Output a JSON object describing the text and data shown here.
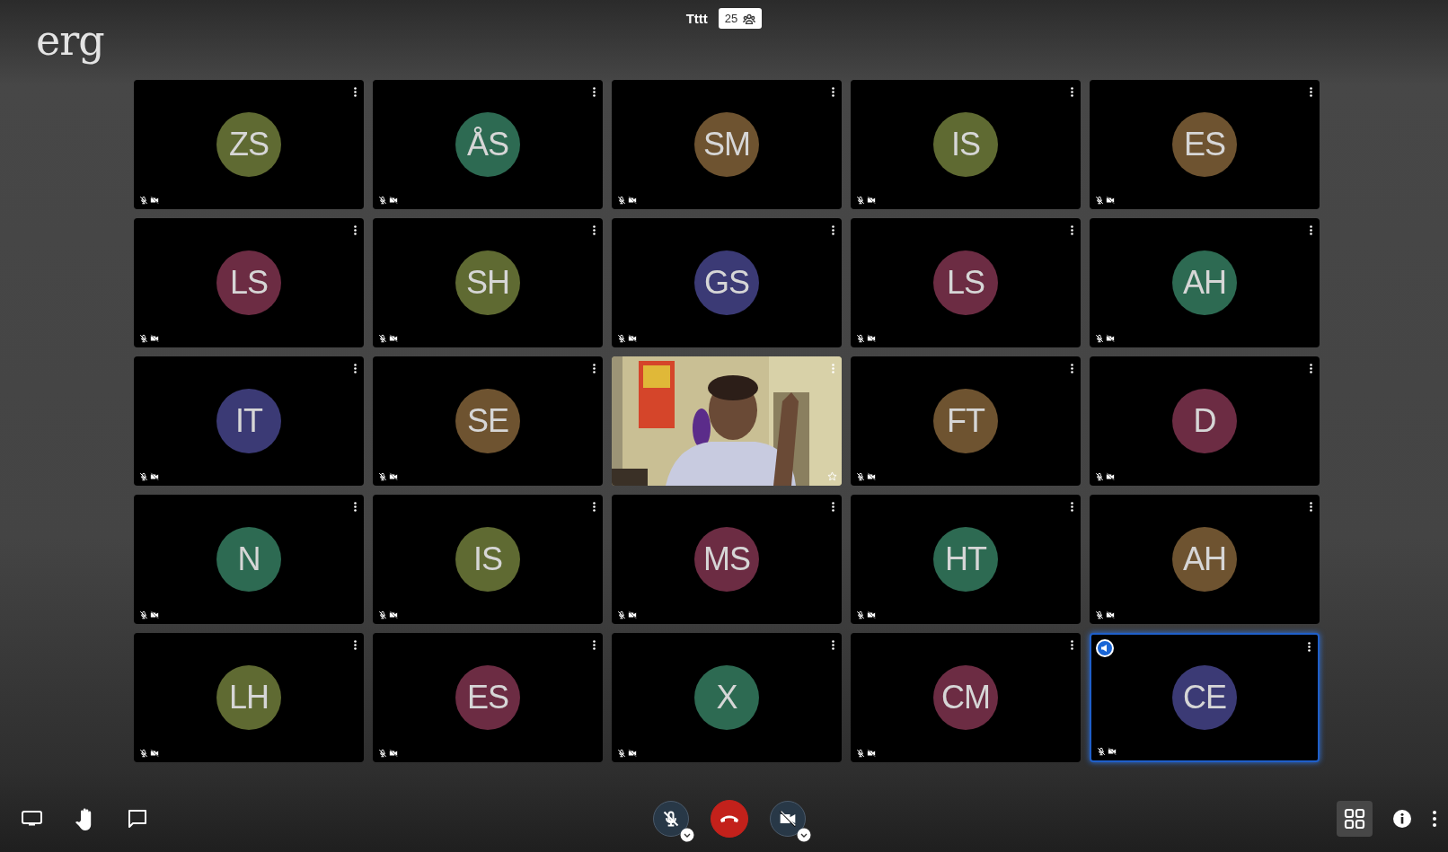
{
  "logo": "erg",
  "meeting": {
    "title": "Tttt",
    "participant_count": "25"
  },
  "tiles": [
    {
      "kind": "avatar",
      "initials": "ZS",
      "color": "#5f6a32",
      "selected": false
    },
    {
      "kind": "avatar",
      "initials": "ÅS",
      "color": "#2d6a52",
      "selected": false
    },
    {
      "kind": "avatar",
      "initials": "SM",
      "color": "#6e5330",
      "selected": false
    },
    {
      "kind": "avatar",
      "initials": "IS",
      "color": "#5f6a32",
      "selected": false
    },
    {
      "kind": "avatar",
      "initials": "ES",
      "color": "#6e5330",
      "selected": false
    },
    {
      "kind": "avatar",
      "initials": "LS",
      "color": "#6c2c43",
      "selected": false
    },
    {
      "kind": "avatar",
      "initials": "SH",
      "color": "#5f6a32",
      "selected": false
    },
    {
      "kind": "avatar",
      "initials": "GS",
      "color": "#3b3a75",
      "selected": false
    },
    {
      "kind": "avatar",
      "initials": "LS",
      "color": "#6c2c43",
      "selected": false
    },
    {
      "kind": "avatar",
      "initials": "AH",
      "color": "#2d6a52",
      "selected": false
    },
    {
      "kind": "avatar",
      "initials": "IT",
      "color": "#3b3a75",
      "selected": false
    },
    {
      "kind": "avatar",
      "initials": "SE",
      "color": "#6e5330",
      "selected": false
    },
    {
      "kind": "video",
      "selected": false
    },
    {
      "kind": "avatar",
      "initials": "FT",
      "color": "#6e5330",
      "selected": false
    },
    {
      "kind": "avatar",
      "initials": "D",
      "color": "#6c2c43",
      "selected": false
    },
    {
      "kind": "avatar",
      "initials": "N",
      "color": "#2d6a52",
      "selected": false
    },
    {
      "kind": "avatar",
      "initials": "IS",
      "color": "#5f6a32",
      "selected": false
    },
    {
      "kind": "avatar",
      "initials": "MS",
      "color": "#6c2c43",
      "selected": false
    },
    {
      "kind": "avatar",
      "initials": "HT",
      "color": "#2d6a52",
      "selected": false
    },
    {
      "kind": "avatar",
      "initials": "AH",
      "color": "#6e5330",
      "selected": false
    },
    {
      "kind": "avatar",
      "initials": "LH",
      "color": "#5f6a32",
      "selected": false
    },
    {
      "kind": "avatar",
      "initials": "ES",
      "color": "#6c2c43",
      "selected": false
    },
    {
      "kind": "avatar",
      "initials": "X",
      "color": "#2d6a52",
      "selected": false
    },
    {
      "kind": "avatar",
      "initials": "CM",
      "color": "#6c2c43",
      "selected": false
    },
    {
      "kind": "avatar",
      "initials": "CE",
      "color": "#3b3a75",
      "selected": true
    }
  ]
}
